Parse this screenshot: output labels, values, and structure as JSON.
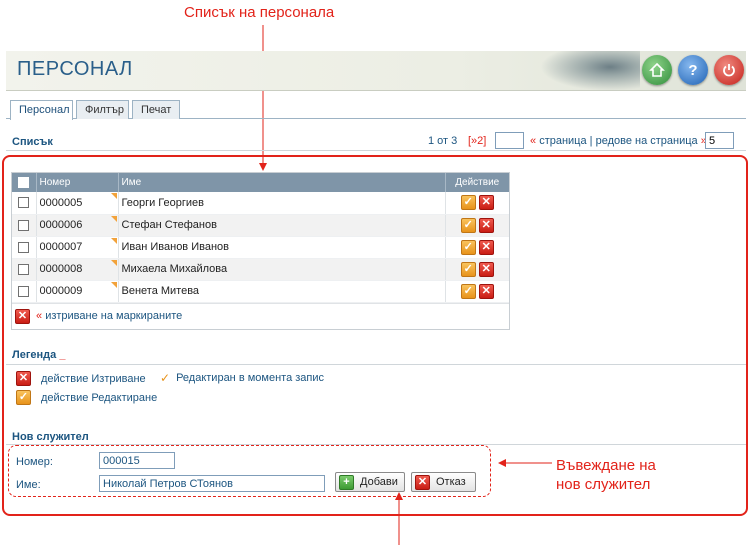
{
  "annotations": {
    "top_label": "Списък на персонала",
    "right_label_line1": "Въвеждане на",
    "right_label_line2": "нов служител"
  },
  "header": {
    "title": "ПЕРСОНАЛ",
    "buttons": [
      {
        "icon": "home-icon"
      },
      {
        "icon": "help-icon",
        "glyph": "?"
      },
      {
        "icon": "power-icon",
        "glyph": "⏻"
      }
    ]
  },
  "tabs": [
    {
      "label": "Персонал",
      "active": true
    },
    {
      "label": "Филтър",
      "active": false
    },
    {
      "label": "Печат",
      "active": false
    }
  ],
  "list": {
    "title": "Списък",
    "pager": {
      "position": "1 от 3",
      "next_page": "[»2]",
      "page_input": "",
      "left_arrow": "«",
      "page_label": "страница",
      "separator": "|",
      "rows_label": "редове на страница",
      "right_arrow": "»",
      "rows_per_page": "5"
    },
    "columns": {
      "number": "Номер",
      "name": "Име",
      "action": "Действие"
    },
    "rows": [
      {
        "number": "0000005",
        "name": "Георги Георгиев"
      },
      {
        "number": "0000006",
        "name": "Стефан Стефанов"
      },
      {
        "number": "0000007",
        "name": "Иван Иванов Иванов"
      },
      {
        "number": "0000008",
        "name": "Михаела Михайлова"
      },
      {
        "number": "0000009",
        "name": "Венета Митева"
      }
    ],
    "delete_marked_arrow": "«",
    "delete_marked": "изтриване на маркираните"
  },
  "legend": {
    "title": "Легенда",
    "title_suffix": "_",
    "delete_action": "действие Изтриване",
    "edited_record": "Редактиран в момента запис",
    "edit_action": "действие Редактиране"
  },
  "new_employee": {
    "title": "Нов служител",
    "number_label": "Номер:",
    "number_value": "000015",
    "name_label": "Име:",
    "name_value": "Николай Петров СТоянов",
    "add_button": "Добави",
    "cancel_button": "Отказ"
  },
  "colors": {
    "accent": "#1c5580",
    "annotation_red": "#e2231a",
    "grid_header": "#7f95a8"
  }
}
